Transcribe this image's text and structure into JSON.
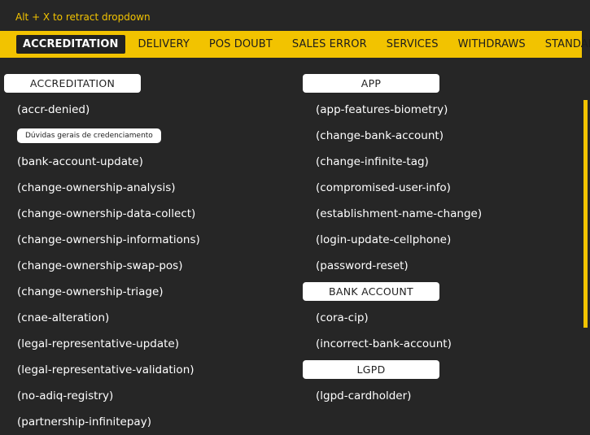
{
  "hint": "Alt + X to retract dropdown",
  "tabs": [
    {
      "label": "ACCREDITATION",
      "active": true
    },
    {
      "label": "DELIVERY"
    },
    {
      "label": "POS DOUBT"
    },
    {
      "label": "SALES ERROR"
    },
    {
      "label": "SERVICES"
    },
    {
      "label": "WITHDRAWS"
    },
    {
      "label": "STANDALONE"
    }
  ],
  "left": {
    "header": "ACCREDITATION",
    "items": [
      "(accr-denied)",
      "Dúvidas gerais de credenciamento",
      "(bank-account-update)",
      "(change-ownership-analysis)",
      "(change-ownership-data-collect)",
      "(change-ownership-informations)",
      "(change-ownership-swap-pos)",
      "(change-ownership-triage)",
      "(cnae-alteration)",
      "(legal-representative-update)",
      "(legal-representative-validation)",
      "(no-adiq-registry)",
      "(partnership-infinitepay)"
    ]
  },
  "right": {
    "app": {
      "header": "APP",
      "items": [
        "(app-features-biometry)",
        "(change-bank-account)",
        "(change-infinite-tag)",
        "(compromised-user-info)",
        "(establishment-name-change)",
        "(login-update-cellphone)",
        "(password-reset)"
      ]
    },
    "bank": {
      "header": "BANK ACCOUNT",
      "items": [
        "(cora-cip)",
        "(incorrect-bank-account)"
      ]
    },
    "lgpd": {
      "header": "LGPD",
      "items": [
        "(lgpd-cardholder)"
      ]
    }
  },
  "colors": {
    "accent": "#f2c300",
    "background": "#262626"
  }
}
